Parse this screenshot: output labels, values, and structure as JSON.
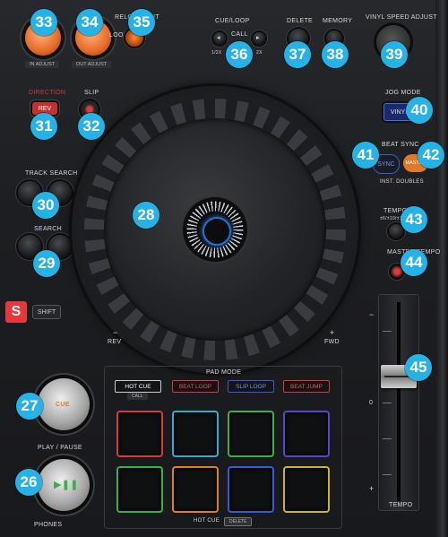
{
  "top_left": {
    "in_adjust_caption": "IN ADJUST",
    "out_adjust_caption": "OUT ADJUST",
    "reloop_exit_label": "RELOOP/EXIT",
    "loop_label": "LOOP"
  },
  "cue_loop": {
    "title": "CUE/LOOP",
    "call_label": "CALL",
    "half_label": "1/2X",
    "double_label": "2X"
  },
  "delete_label": "DELETE",
  "memory_label": "MEMORY",
  "vinyl_speed_label": "VINYL SPEED ADJUST",
  "direction": {
    "title": "DIRECTION",
    "rev_label": "REV"
  },
  "slip_label": "SLIP",
  "jog_mode": {
    "title": "JOG MODE",
    "vinyl_label": "VINYL"
  },
  "beat_sync": {
    "title": "BEAT SYNC",
    "sync_label": "SYNC",
    "master_label": "MASTER",
    "inst_doubles_label": "INST. DOUBLES"
  },
  "track_search_label": "TRACK SEARCH",
  "search_label": "SEARCH",
  "tempo_range_label": "TEMPO",
  "tempo_range_values": "±6/±10/±16/WIDE",
  "master_tempo_label": "MASTER TEMPO",
  "shift_badge": "S",
  "shift_label": "SHIFT",
  "jog_rev_label": "REV",
  "jog_fwd_label": "FWD",
  "jog_minus": "−",
  "jog_plus": "+",
  "pad_mode": {
    "title": "PAD MODE",
    "modes": [
      "HOT CUE",
      "BEAT LOOP",
      "SLIP LOOP",
      "BEAT JUMP"
    ],
    "call_label": "CALL",
    "footer_hot_cue": "HOT CUE",
    "footer_delete": "DELETE"
  },
  "cue_knob_label": "CUE",
  "play_pause_label": "PLAY / PAUSE",
  "phones_label": "PHONES",
  "tempo_label": "TEMPO",
  "fader_minus": "−",
  "fader_zero": "0",
  "fader_plus": "+",
  "callouts": [
    "33",
    "34",
    "35",
    "36",
    "37",
    "38",
    "39",
    "31",
    "32",
    "40",
    "41",
    "42",
    "30",
    "28",
    "43",
    "29",
    "44",
    "45",
    "27",
    "26"
  ],
  "colors": {
    "badge": "#27b2e6",
    "pad_red": "#d43b3b",
    "pad_cyan": "#38a9c9",
    "pad_green": "#3fae4a",
    "pad_purple": "#5b45c8",
    "pad_orange": "#d9822b",
    "pad_blue": "#3a5bd1",
    "pad_yellow": "#cbb62a"
  }
}
